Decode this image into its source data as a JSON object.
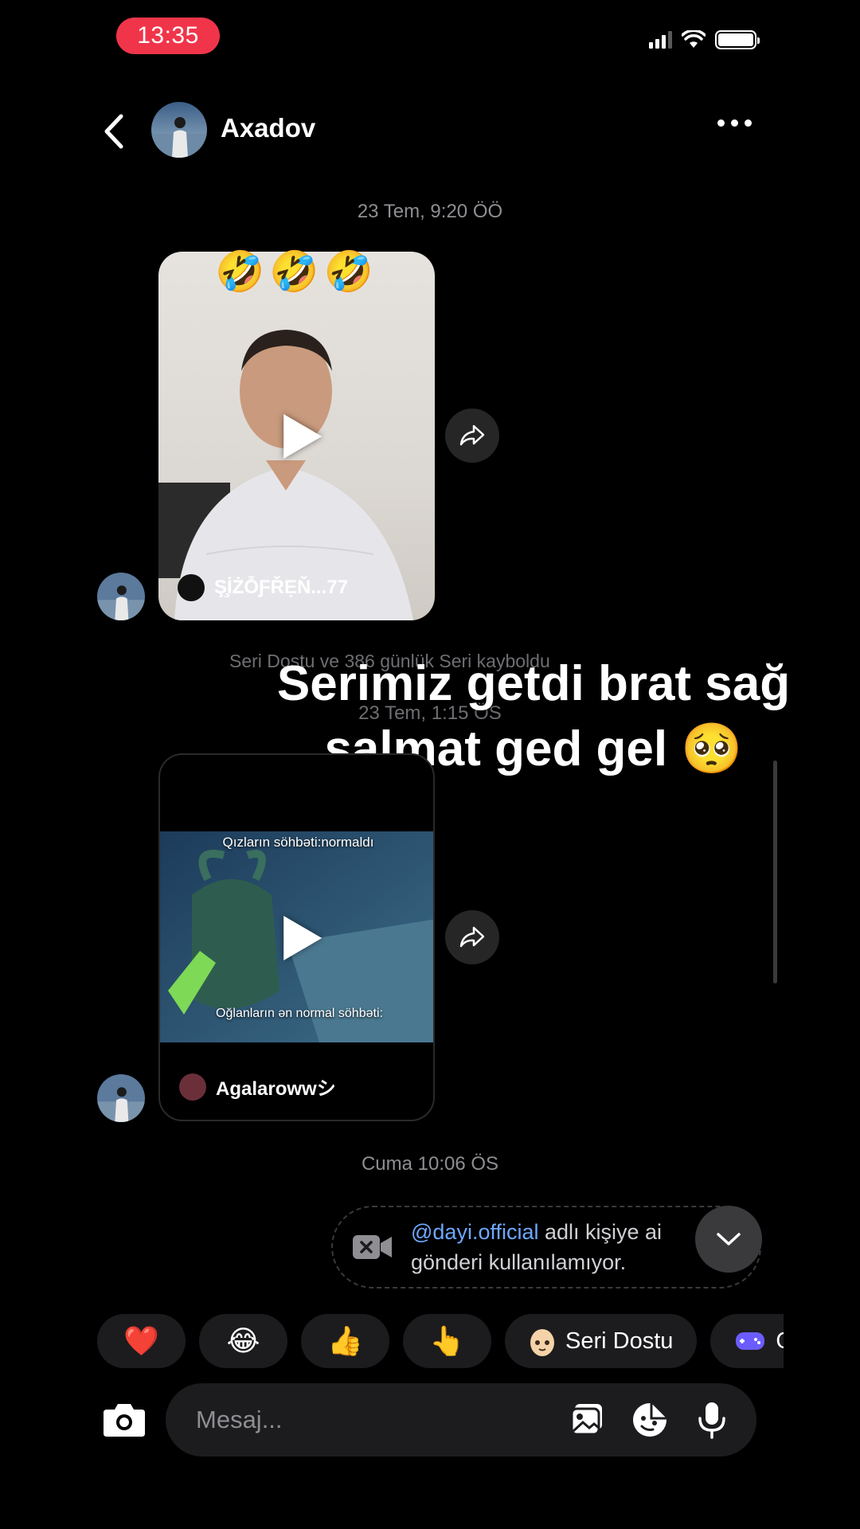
{
  "status_bar": {
    "time": "13:35"
  },
  "header": {
    "contact_name": "Axadov"
  },
  "messages": {
    "ts1": "23 Tem, 9:20 ÖÖ",
    "reel1": {
      "emojis": "🤣🤣🤣",
      "username": "Ş̧İŻỖƑŘẸŇ...77"
    },
    "streak_note": "Seri Dostu ve 386 günlük Seri kayboldu",
    "overlay_text": "Serimiz getdi brat sağ salmat ged gel 🥺",
    "ts2": "23 Tem, 1:15 ÖS",
    "reel2": {
      "top_caption": "Qızların söhbəti:normaldı",
      "bottom_caption": "Oğlanların ən normal söhbəti:",
      "username": "Agalarowwシ"
    },
    "ts3": "Cuma 10:06 ÖS",
    "unavailable": {
      "mention": "@dayi.official",
      "text_after_mention": " adlı kişiye ai",
      "line2": "gönderi kullanılamıyor."
    }
  },
  "quick_reactions": [
    "❤️",
    "😂",
    "👍",
    "👆"
  ],
  "quick_chips": {
    "seri_dostu": "Seri Dostu",
    "games_partial": "O"
  },
  "composer": {
    "placeholder": "Mesaj..."
  },
  "colors": {
    "status_pill": "#f0354a",
    "mention": "#6ea8ff",
    "chip_bg": "#1c1c1e"
  }
}
